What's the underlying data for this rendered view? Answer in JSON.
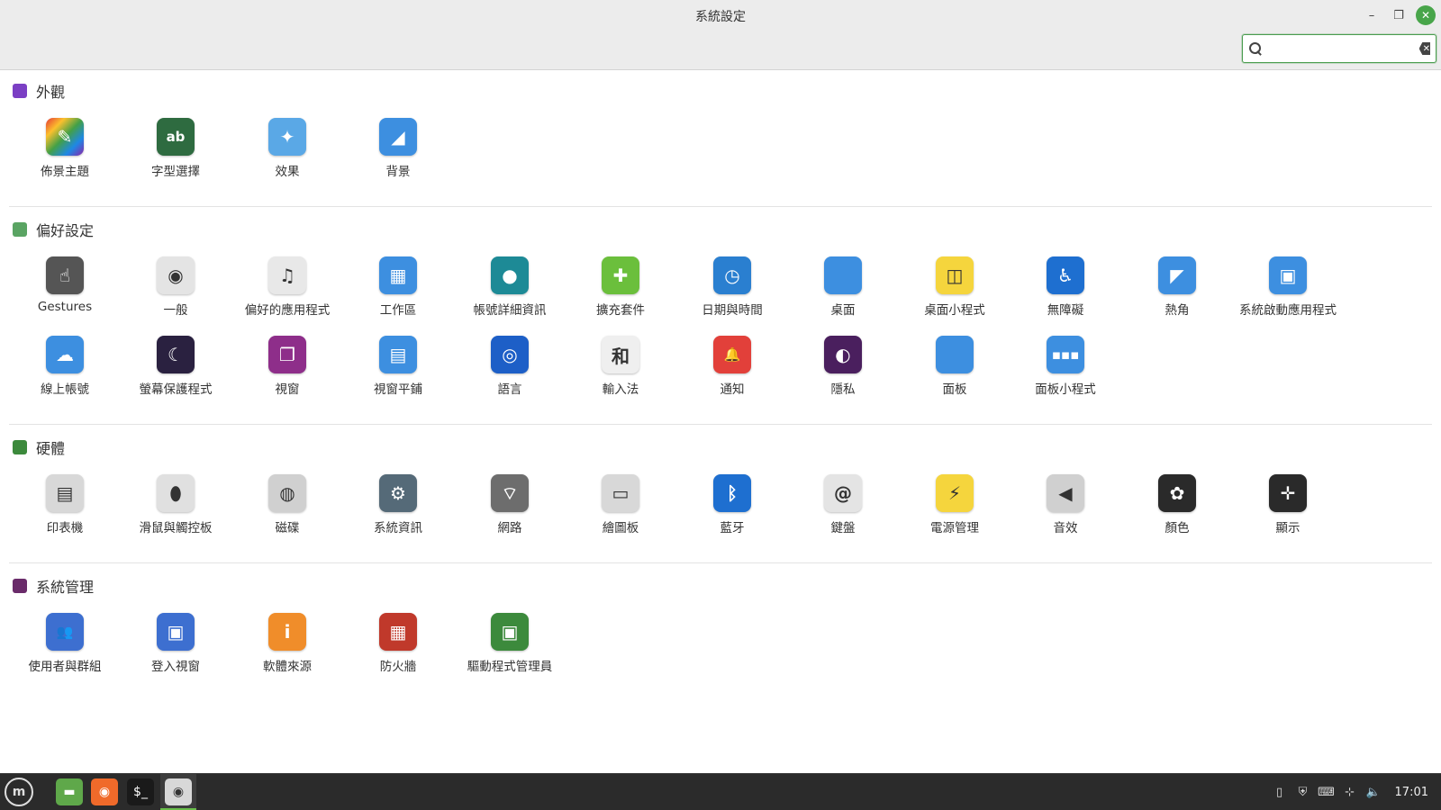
{
  "window": {
    "title": "系統設定"
  },
  "search": {
    "value": "",
    "placeholder": ""
  },
  "sections": [
    {
      "title": "外觀",
      "color": "#7b3fc4",
      "items": [
        {
          "label": "佈景主題",
          "icon": "themes-icon",
          "bg": "linear-gradient(135deg,#e53935,#fbc02d,#43a047,#1e88e5,#8e24aa)",
          "glyph": "✎"
        },
        {
          "label": "字型選擇",
          "icon": "fonts-icon",
          "bg": "#2e6b40",
          "glyph": "ab"
        },
        {
          "label": "效果",
          "icon": "effects-icon",
          "bg": "#5aa8e6",
          "glyph": "✦"
        },
        {
          "label": "背景",
          "icon": "backgrounds-icon",
          "bg": "#3d8fe0",
          "glyph": "◢"
        }
      ]
    },
    {
      "title": "偏好設定",
      "color": "#5aa463",
      "items": [
        {
          "label": "Gestures",
          "icon": "gestures-icon",
          "bg": "#555555",
          "glyph": "☝"
        },
        {
          "label": "一般",
          "icon": "general-icon",
          "bg": "#e4e4e4",
          "glyph": "◉"
        },
        {
          "label": "偏好的應用程式",
          "icon": "preferred-apps-icon",
          "bg": "#e8e8e8",
          "glyph": "♫"
        },
        {
          "label": "工作區",
          "icon": "workspaces-icon",
          "bg": "#3d8fe0",
          "glyph": "▦"
        },
        {
          "label": "帳號詳細資訊",
          "icon": "account-icon",
          "bg": "#1d8a96",
          "glyph": "●"
        },
        {
          "label": "擴充套件",
          "icon": "extensions-icon",
          "bg": "#6bbf3c",
          "glyph": "✚"
        },
        {
          "label": "日期與時間",
          "icon": "date-time-icon",
          "bg": "#2a7fd0",
          "glyph": "◷"
        },
        {
          "label": "桌面",
          "icon": "desktop-icon",
          "bg": "#3d8fe0",
          "glyph": ""
        },
        {
          "label": "桌面小程式",
          "icon": "desklets-icon",
          "bg": "#f5d53d",
          "glyph": "◫"
        },
        {
          "label": "無障礙",
          "icon": "accessibility-icon",
          "bg": "#1e6fd0",
          "glyph": "♿"
        },
        {
          "label": "熱角",
          "icon": "hot-corners-icon",
          "bg": "#3d8fe0",
          "glyph": "◤"
        },
        {
          "label": "系統啟動應用程式",
          "icon": "startup-apps-icon",
          "bg": "#3d8fe0",
          "glyph": "▣"
        },
        {
          "label": "線上帳號",
          "icon": "online-accounts-icon",
          "bg": "#3d8fe0",
          "glyph": "☁"
        },
        {
          "label": "螢幕保護程式",
          "icon": "screensaver-icon",
          "bg": "#2a2140",
          "glyph": "☾"
        },
        {
          "label": "視窗",
          "icon": "windows-icon",
          "bg": "#8e2e8a",
          "glyph": "❐"
        },
        {
          "label": "視窗平鋪",
          "icon": "window-tiling-icon",
          "bg": "#3d8fe0",
          "glyph": "▤"
        },
        {
          "label": "語言",
          "icon": "languages-icon",
          "bg": "#1d5fc7",
          "glyph": "◎"
        },
        {
          "label": "輸入法",
          "icon": "input-method-icon",
          "bg": "#efefef",
          "glyph": "和"
        },
        {
          "label": "通知",
          "icon": "notifications-icon",
          "bg": "#e2403a",
          "glyph": "🔔"
        },
        {
          "label": "隱私",
          "icon": "privacy-icon",
          "bg": "#4a1f5e",
          "glyph": "◐"
        },
        {
          "label": "面板",
          "icon": "panel-icon",
          "bg": "#3d8fe0",
          "glyph": ""
        },
        {
          "label": "面板小程式",
          "icon": "applets-icon",
          "bg": "#3d8fe0",
          "glyph": "▪▪▪"
        }
      ]
    },
    {
      "title": "硬體",
      "color": "#3c8a3c",
      "items": [
        {
          "label": "印表機",
          "icon": "printer-icon",
          "bg": "#d8d8d8",
          "glyph": "▤"
        },
        {
          "label": "滑鼠與觸控板",
          "icon": "mouse-icon",
          "bg": "#e0e0e0",
          "glyph": "⬮"
        },
        {
          "label": "磁碟",
          "icon": "disks-icon",
          "bg": "#d0d0d0",
          "glyph": "◍"
        },
        {
          "label": "系統資訊",
          "icon": "system-info-icon",
          "bg": "#556a78",
          "glyph": "⚙"
        },
        {
          "label": "網路",
          "icon": "network-icon",
          "bg": "#6d6d6d",
          "glyph": "⌔"
        },
        {
          "label": "繪圖板",
          "icon": "graphics-tablet-icon",
          "bg": "#d8d8d8",
          "glyph": "▭"
        },
        {
          "label": "藍牙",
          "icon": "bluetooth-icon",
          "bg": "#1e6fd0",
          "glyph": "ᛒ"
        },
        {
          "label": "鍵盤",
          "icon": "keyboard-icon",
          "bg": "#e4e4e4",
          "glyph": "@"
        },
        {
          "label": "電源管理",
          "icon": "power-icon",
          "bg": "#f5d53d",
          "glyph": "⚡"
        },
        {
          "label": "音效",
          "icon": "sound-icon",
          "bg": "#d0d0d0",
          "glyph": "◀"
        },
        {
          "label": "顏色",
          "icon": "color-icon",
          "bg": "#2a2a2a",
          "glyph": "✿"
        },
        {
          "label": "顯示",
          "icon": "display-icon",
          "bg": "#2a2a2a",
          "glyph": "✛"
        }
      ]
    },
    {
      "title": "系統管理",
      "color": "#6a2b6a",
      "items": [
        {
          "label": "使用者與群組",
          "icon": "users-groups-icon",
          "bg": "#3d6fd0",
          "glyph": "👥"
        },
        {
          "label": "登入視窗",
          "icon": "login-window-icon",
          "bg": "#3d6fd0",
          "glyph": "▣"
        },
        {
          "label": "軟體來源",
          "icon": "software-sources-icon",
          "bg": "#f08d2a",
          "glyph": "i"
        },
        {
          "label": "防火牆",
          "icon": "firewall-icon",
          "bg": "#c0392b",
          "glyph": "▦"
        },
        {
          "label": "驅動程式管理員",
          "icon": "driver-manager-icon",
          "bg": "#3c8a3c",
          "glyph": "▣"
        }
      ]
    }
  ],
  "taskbar": {
    "menu_icon": "mint-menu-icon",
    "apps": [
      {
        "name": "files-icon",
        "bg": "#5fa84a",
        "glyph": "▬"
      },
      {
        "name": "firefox-icon",
        "bg": "#f06a2a",
        "glyph": "◉"
      },
      {
        "name": "terminal-icon",
        "bg": "#1a1a1a",
        "glyph": "$_"
      },
      {
        "name": "system-settings-icon",
        "bg": "#d8d8d8",
        "glyph": "◉"
      }
    ],
    "tray_icons": [
      "clipboard-icon",
      "shield-icon",
      "keyboard-icon",
      "network-icon",
      "volume-icon"
    ],
    "clock": "17:01"
  }
}
